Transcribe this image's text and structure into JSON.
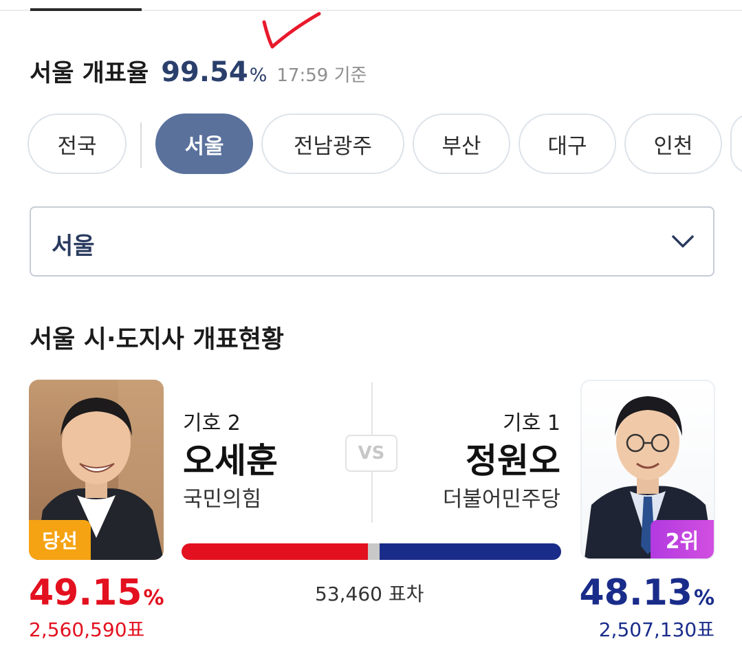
{
  "header": {
    "title": "서울 개표율",
    "rate_value": "99.54",
    "rate_unit": "%",
    "updated": "17:59 기준"
  },
  "region_tabs": [
    "전국",
    "서울",
    "전남광주",
    "부산",
    "대구",
    "인천"
  ],
  "selected_tab": "서울",
  "region_select": {
    "value": "서울"
  },
  "section_title": "서울 시·도지사 개표현황",
  "vs_label": "VS",
  "candidates": {
    "left": {
      "number": "기호 2",
      "name": "오세훈",
      "party": "국민의힘",
      "badge": "당선",
      "percent": "49.15",
      "percent_unit": "%",
      "votes": "2,560,590표",
      "color": "#e3101f"
    },
    "right": {
      "number": "기호 1",
      "name": "정원오",
      "party": "더불어민주당",
      "badge": "2위",
      "percent": "48.13",
      "percent_unit": "%",
      "votes": "2,507,130표",
      "color": "#1a2c8a"
    }
  },
  "vote_difference": "53,460 표차",
  "colors": {
    "accent_tab": "#5a719c",
    "rate_text": "#2a3f6b",
    "win_badge": "#f5a313",
    "rank_badge": "#c044e0"
  }
}
